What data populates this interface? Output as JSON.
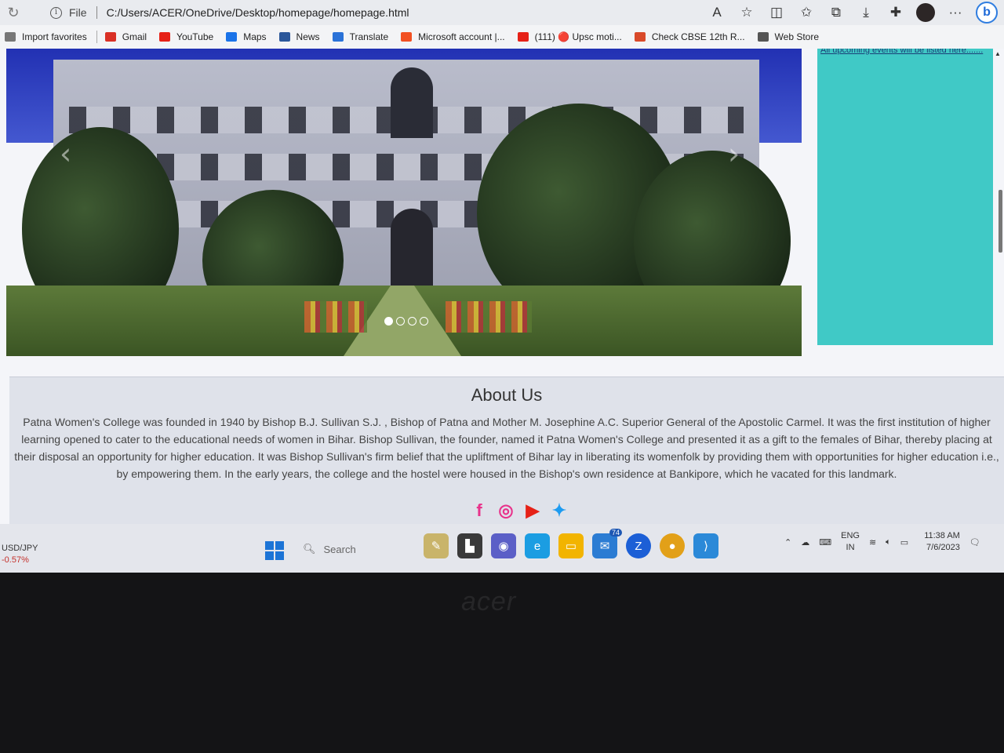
{
  "browser": {
    "file_label": "File",
    "url": "C:/Users/ACER/OneDrive/Desktop/homepage/homepage.html",
    "favorites": [
      {
        "label": "Import favorites",
        "color": "#777777"
      },
      {
        "label": "Gmail",
        "color": "#d93025"
      },
      {
        "label": "YouTube",
        "color": "#e62117"
      },
      {
        "label": "Maps",
        "color": "#1a73e8"
      },
      {
        "label": "News",
        "color": "#2b579a"
      },
      {
        "label": "Translate",
        "color": "#2a72d8"
      },
      {
        "label": "Microsoft account |...",
        "color": "#f25022"
      },
      {
        "label": "(111) 🔴 Upsc moti...",
        "color": "#e62117"
      },
      {
        "label": "Check CBSE 12th R...",
        "color": "#d94a2a"
      },
      {
        "label": "Web Store",
        "color": "#555555"
      }
    ]
  },
  "page": {
    "events_text": "All upcoming events will be listed here.......",
    "about_title": "About Us",
    "about_text": "Patna Women's College was founded in 1940 by Bishop B.J. Sullivan S.J. , Bishop of Patna and Mother M. Josephine A.C. Superior General of the Apostolic Carmel. It was the first institution of higher learning opened to cater to the educational needs of women in Bihar. Bishop Sullivan, the founder, named it Patna Women's College and presented it as a gift to the females of Bihar, thereby placing at their disposal an opportunity for higher education. It was Bishop Sullivan's firm belief that the upliftment of Bihar lay in liberating its womenfolk by providing them with opportunities for higher education i.e., by empowering them. In the early years, the college and the hostel were housed in the Bishop's own residence at Bankipore, which he vacated for this landmark.",
    "social": [
      {
        "name": "facebook-icon",
        "glyph": "f",
        "color": "#e8338b"
      },
      {
        "name": "instagram-icon",
        "glyph": "◎",
        "color": "#e8338b"
      },
      {
        "name": "youtube-icon",
        "glyph": "▶",
        "color": "#e62117"
      },
      {
        "name": "twitter-icon",
        "glyph": "✦",
        "color": "#1d9bf0"
      }
    ],
    "carousel_dots": 4,
    "carousel_active": 0
  },
  "taskbar": {
    "ticker_symbol": "USD/JPY",
    "ticker_change": "-0.57%",
    "search_placeholder": "Search",
    "mail_badge": "74",
    "lang_top": "ENG",
    "lang_bottom": "IN",
    "time": "11:38 AM",
    "date": "7/6/2023"
  },
  "bezel": {
    "brand": "acer"
  }
}
